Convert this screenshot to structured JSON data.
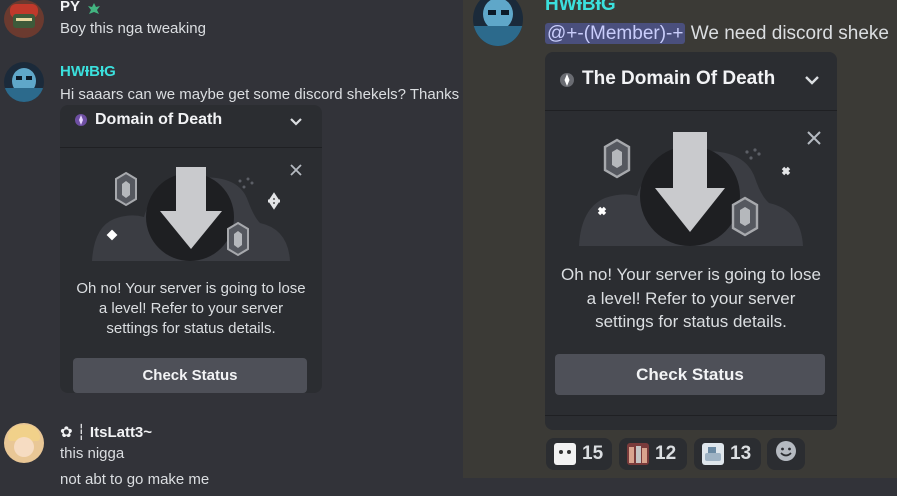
{
  "left": {
    "messages": [
      {
        "username": "PY",
        "username_color": "#f2f3f5",
        "text": "Boy this nga tweaking"
      },
      {
        "username": "HWƗBƗG",
        "username_color": "#3be0dd",
        "text": "Hi saaars can we maybe get some discord shekels? Thanks"
      },
      {
        "username": "✿ ┆ ItsLatt3~",
        "username_color": "#f2f3f5",
        "lines": [
          "this nigga",
          "not abt to go make me"
        ]
      }
    ],
    "card": {
      "title": "Domain of Death",
      "body": "Oh no! Your server is going to lose a level! Refer to your server settings for status details.",
      "button": "Check Status"
    }
  },
  "right": {
    "username": "HWƗBƗG",
    "username_color": "#3be0dd",
    "mention": "@+-(Member)-+",
    "text": "We need discord sheke",
    "card": {
      "title": "The Domain Of Death",
      "body": "Oh no! Your server is going to lose a level! Refer to your server settings for status details.",
      "button": "Check Status"
    },
    "reactions": [
      {
        "count": "15",
        "emoji": "anime-face-emoji"
      },
      {
        "count": "12",
        "emoji": "group-photo-emoji"
      },
      {
        "count": "13",
        "emoji": "sketch-emoji"
      }
    ]
  }
}
